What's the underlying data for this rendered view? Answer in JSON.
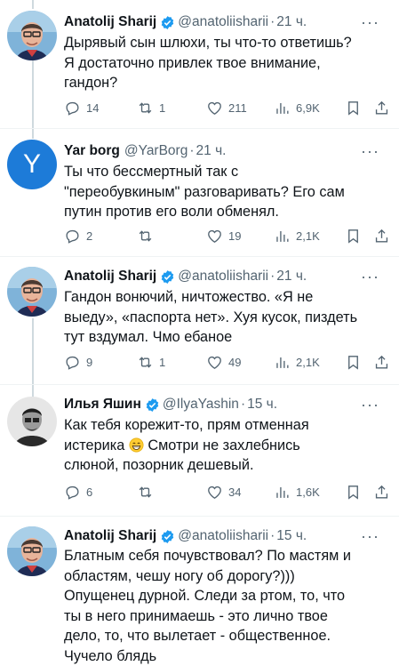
{
  "tweets": [
    {
      "name": "Anatolij Sharij",
      "verified": true,
      "handle": "@anatoliisharii",
      "dot": "·",
      "time": "21 ч.",
      "lines": [
        "Дырявый сын шлюхи, ты что-то ответишь?",
        "Я достаточно привлек твое внимание,",
        "гандон?"
      ],
      "replies": "14",
      "retweets": "1",
      "likes": "211",
      "views": "6,9K",
      "avatar": "photo-man-glasses"
    },
    {
      "name": "Yar borg",
      "verified": false,
      "handle": "@YarBorg",
      "dot": "·",
      "time": "21 ч.",
      "lines": [
        "Ты что бессмертный так с",
        "\"переобувкиным\" разговаривать? Его сам",
        "путин против его воли обменял."
      ],
      "replies": "2",
      "retweets": "",
      "likes": "19",
      "views": "2,1K",
      "avatar_letter": "Y"
    },
    {
      "name": "Anatolij Sharij",
      "verified": true,
      "handle": "@anatoliisharii",
      "dot": "·",
      "time": "21 ч.",
      "lines": [
        "Гандон вонючий, ничтожество. «Я не",
        "выеду», «паспорта нет». Хуя кусок, пиздеть",
        "тут вздумал. Чмо ебаное"
      ],
      "replies": "9",
      "retweets": "1",
      "likes": "49",
      "views": "2,1K",
      "avatar": "photo-man-glasses"
    },
    {
      "name": "Илья Яшин",
      "verified": true,
      "handle": "@IlyaYashin",
      "dot": "·",
      "time": "15 ч.",
      "lines": [
        "Как тебя корежит-то, прям отменная",
        "истерика",
        "Смотри не захлебнись",
        "слюной, позорник дешевый."
      ],
      "replies": "6",
      "retweets": "",
      "likes": "34",
      "views": "1,6K",
      "avatar": "photo-man-bw"
    },
    {
      "name": "Anatolij Sharij",
      "verified": true,
      "handle": "@anatoliisharii",
      "dot": "·",
      "time": "15 ч.",
      "lines": [
        "Блатным себя почувствовал? По мастям и",
        "областям, чешу ногу об дорогу?)))",
        "Опущенец дурной. Следи за ртом, то, что",
        "ты в него принимаешь - это лично твое",
        "дело, то, что вылетает - общественное.",
        "Чучело блядь"
      ],
      "avatar": "photo-man-glasses"
    }
  ],
  "more_label": "···",
  "colors": {
    "text": "#0f1419",
    "secondary": "#536471",
    "verified": "#1d9bf0",
    "thread_line": "#cfd9de"
  }
}
